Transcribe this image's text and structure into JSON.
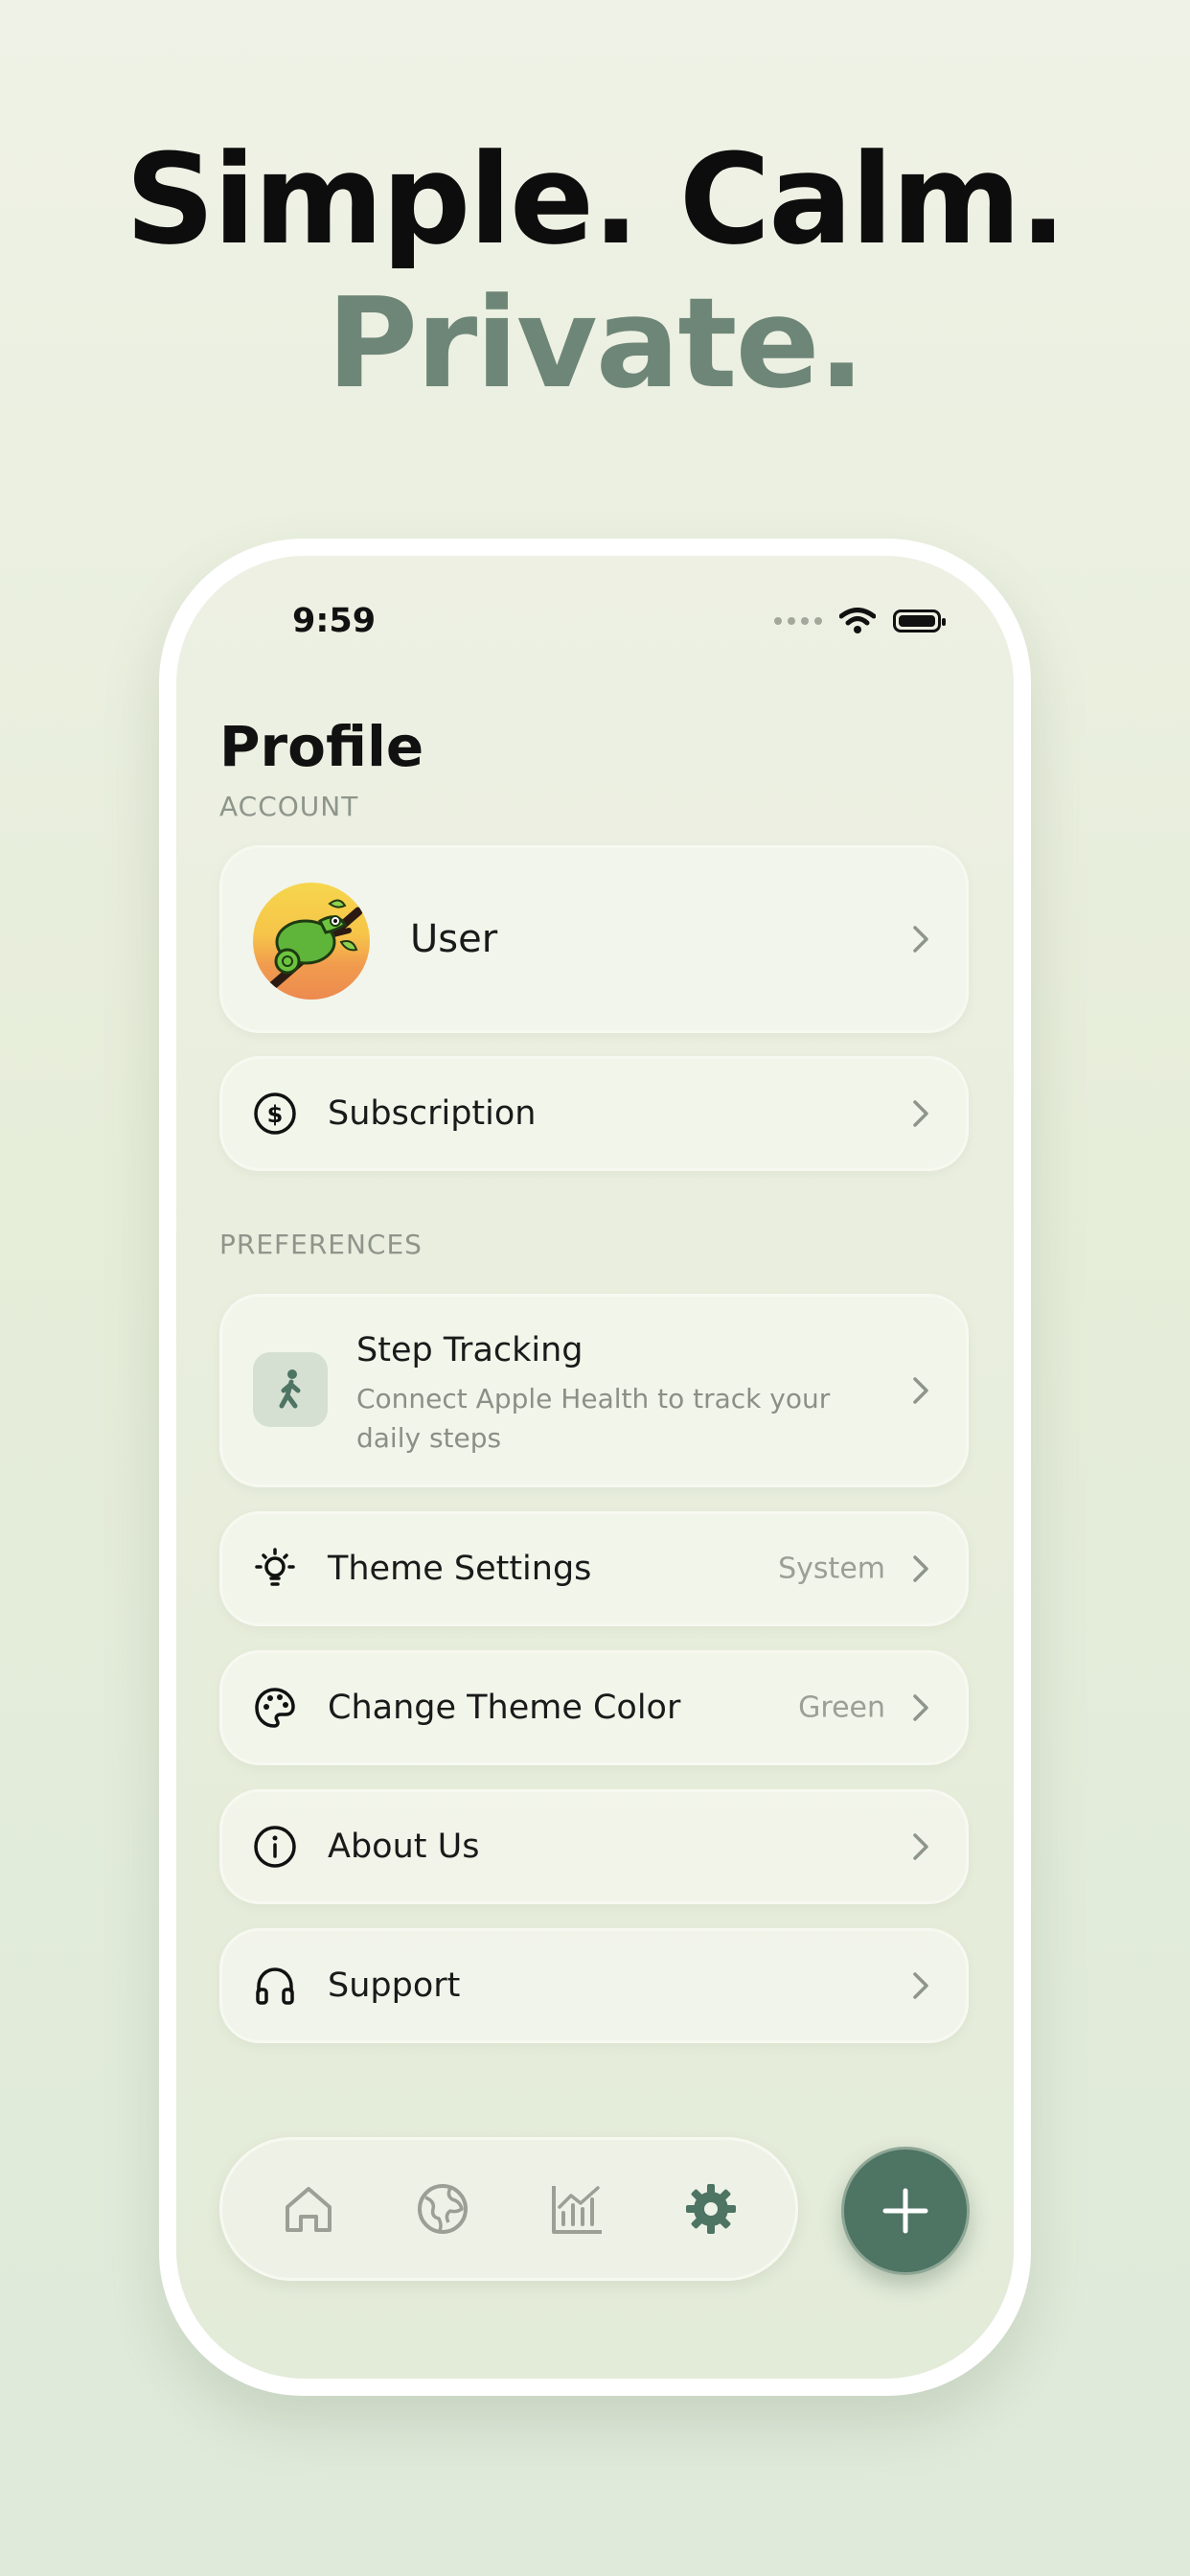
{
  "headline": {
    "line1": "Simple. Calm.",
    "line2": "Private."
  },
  "status_bar": {
    "time": "9:59"
  },
  "page": {
    "title": "Profile"
  },
  "sections": {
    "account": "ACCOUNT",
    "preferences": "PREFERENCES"
  },
  "account": {
    "user_label": "User",
    "subscription_label": "Subscription"
  },
  "preferences": {
    "step_tracking": {
      "title": "Step Tracking",
      "subtitle": "Connect Apple Health to track your daily steps"
    },
    "theme_settings": {
      "label": "Theme Settings",
      "value": "System"
    },
    "change_theme_color": {
      "label": "Change Theme Color",
      "value": "Green"
    },
    "about_us": {
      "label": "About Us"
    },
    "support": {
      "label": "Support"
    }
  },
  "tab_bar": {
    "items": [
      "home-icon",
      "globe-icon",
      "chart-icon",
      "gear-icon"
    ],
    "active": "gear-icon"
  },
  "colors": {
    "accent": "#4e7463",
    "headline_muted": "#6e8677",
    "inactive_icon": "#9aa096"
  }
}
